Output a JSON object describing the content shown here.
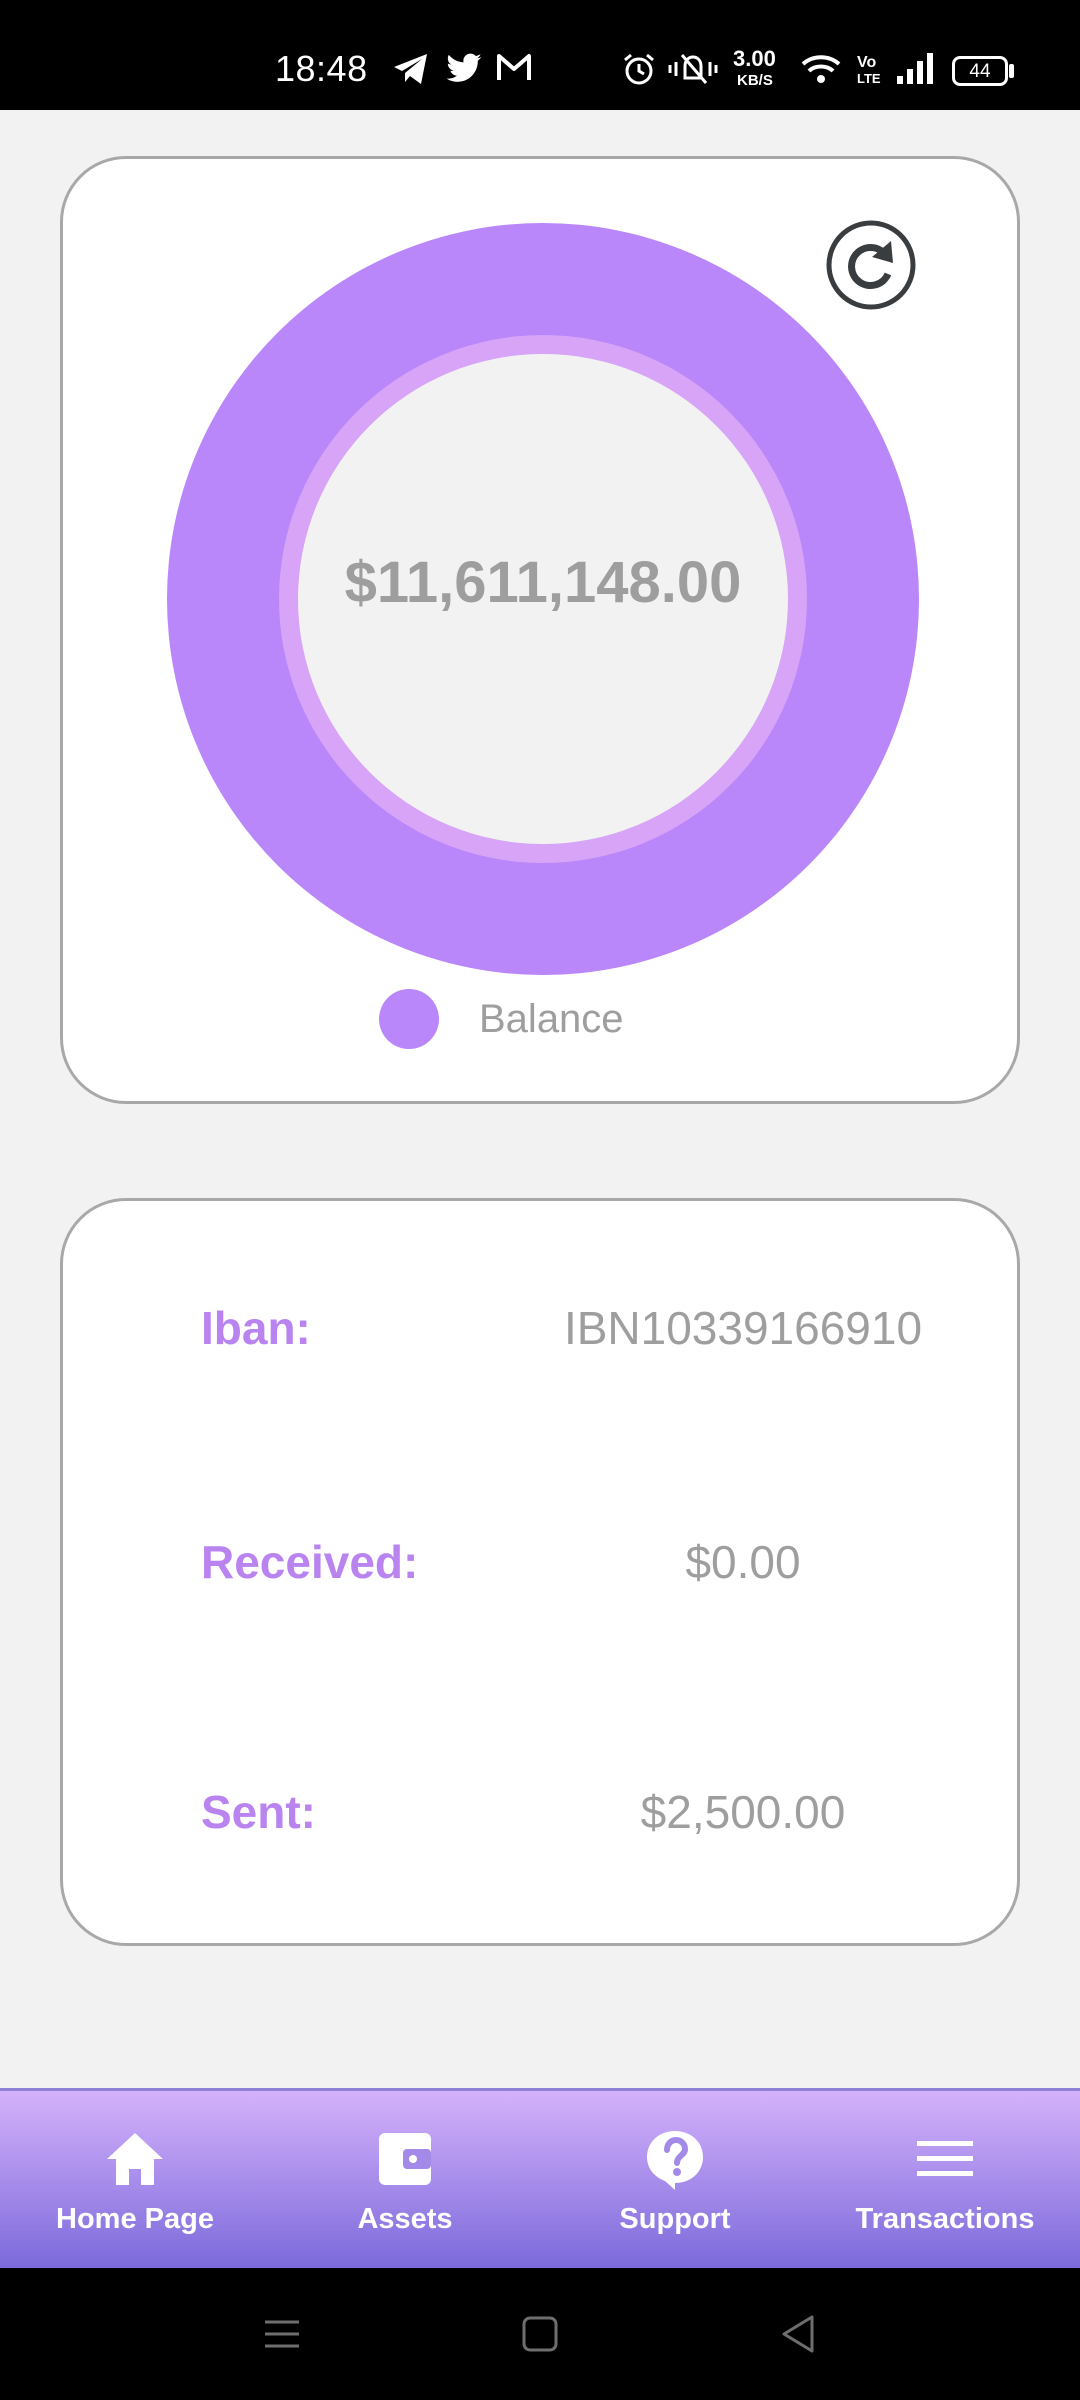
{
  "status_bar": {
    "time": "18:48",
    "net_speed_value": "3.00",
    "net_speed_unit": "KB/S",
    "volte_top": "Vo",
    "volte_bottom": "LTE",
    "battery": "44",
    "icons": [
      "telegram-icon",
      "twitter-icon",
      "gmail-icon",
      "alarm-icon",
      "mute-vibrate-icon",
      "wifi-icon",
      "signal-icon",
      "battery-icon"
    ]
  },
  "balance_card": {
    "amount": "$11,611,148.00",
    "legend_label": "Balance",
    "refresh_icon": "refresh-icon"
  },
  "chart_data": {
    "type": "pie",
    "categories": [
      "Balance"
    ],
    "values": [
      11611148.0
    ],
    "center_label": "$11,611,148.00",
    "legend": "bottom",
    "colors": [
      "#b987f9"
    ]
  },
  "account_info": {
    "rows": [
      {
        "label": "Iban:",
        "value": "IBN10339166910"
      },
      {
        "label": "Received:",
        "value": "$0.00"
      },
      {
        "label": "Sent:",
        "value": "$2,500.00"
      }
    ]
  },
  "bottom_nav": {
    "items": [
      {
        "label": "Home Page",
        "icon": "home-icon"
      },
      {
        "label": "Assets",
        "icon": "wallet-icon"
      },
      {
        "label": "Support",
        "icon": "help-icon"
      },
      {
        "label": "Transactions",
        "icon": "menu-icon"
      }
    ]
  },
  "colors": {
    "accent": "#b987f9",
    "accent_light": "#d7a4f7",
    "label_text": "#b984ef",
    "value_text": "#9e9e9e",
    "nav_gradient_top": "#d4b1fb",
    "nav_gradient_bottom": "#7c6adb",
    "card_border": "#a8a8a8",
    "page_background": "#f2f2f2"
  }
}
